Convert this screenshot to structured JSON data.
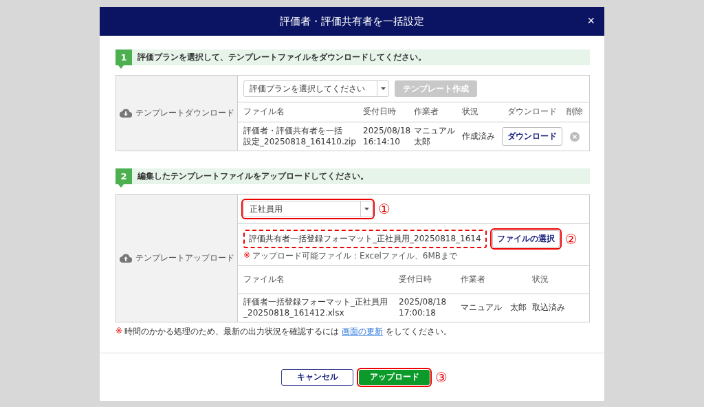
{
  "dialog": {
    "title": "評価者・評価共有者を一括設定",
    "close": "×"
  },
  "step1": {
    "number": "1",
    "text": "評価プランを選択して、テンプレートファイルをダウンロードしてください。",
    "side_label": "テンプレートダウンロード",
    "plan_select": {
      "value": "評価プランを選択してください"
    },
    "create_button": {
      "label": "テンプレート作成",
      "disabled": true
    },
    "columns": [
      "ファイル名",
      "受付日時",
      "作業者",
      "状況",
      "ダウンロード",
      "削除"
    ],
    "rows": [
      {
        "file_name": [
          "評価者・評価共有者を一括",
          "設定_20250818_161410.zip"
        ],
        "received": "2025/08/18\n16:14:10",
        "worker": [
          "マニュアル",
          "太郎"
        ],
        "status": "作成済み",
        "download": "ダウンロード"
      }
    ]
  },
  "step2": {
    "number": "2",
    "text": "編集したテンプレートファイルをアップロードしてください。",
    "side_label": "テンプレートアップロード",
    "type_select": {
      "value": "正社員用",
      "highlighted": true,
      "marker": "①"
    },
    "file_field": {
      "value": "評価共有者一括登録フォーマット_正社員用_20250818_1614",
      "highlighted": true,
      "dashed": true
    },
    "choose_button": {
      "label": "ファイルの選択",
      "highlighted": true,
      "marker": "②"
    },
    "hint": {
      "mark": "※",
      "text": "アップロード可能ファイル：Excelファイル、6MBまで"
    },
    "columns": [
      "ファイル名",
      "受付日時",
      "作業者",
      "状況"
    ],
    "rows": [
      {
        "file_name": [
          "評価者一括登録フォーマット_正社員用",
          "_20250818_161412.xlsx"
        ],
        "received": "2025/08/18\n17:00:18",
        "worker": "マニュアル　太郎",
        "status": "取込済み"
      }
    ]
  },
  "note": {
    "mark": "※",
    "before": "時間のかかる処理のため、最新の出力状況を確認するには",
    "link": "画面の更新",
    "after": "をしてください。"
  },
  "footer": {
    "cancel": "キャンセル",
    "upload": {
      "label": "アップロード",
      "highlighted": true,
      "marker": "③"
    }
  }
}
